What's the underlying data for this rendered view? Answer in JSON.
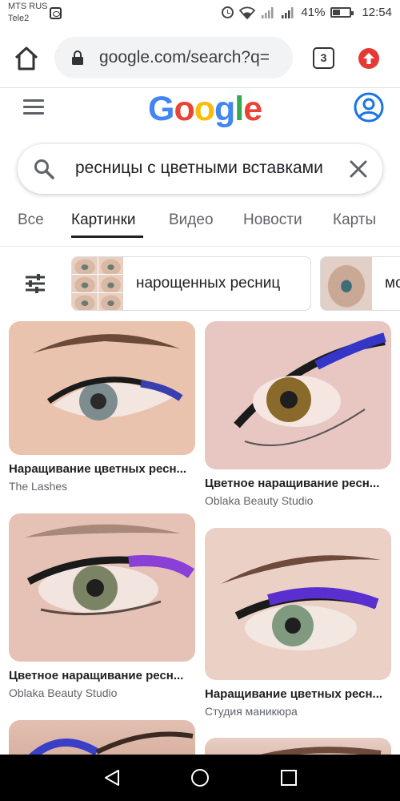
{
  "status_bar": {
    "carrier_1": "MTS RUS",
    "carrier_2": "Tele2",
    "battery": "41%",
    "time": "12:54",
    "icons": [
      "sim-icon",
      "alarm-icon",
      "wifi-icon",
      "signal-icon",
      "signal-icon",
      "battery-icon"
    ]
  },
  "browser": {
    "url": "google.com/search?q=",
    "tab_count": "3",
    "icons": [
      "home-icon",
      "lock-icon",
      "tabs-icon",
      "update-icon"
    ]
  },
  "google": {
    "logo": "Google",
    "icons": [
      "menu-icon",
      "account-icon"
    ]
  },
  "search": {
    "query": "ресницы с цветными вставками",
    "icons": [
      "search-icon",
      "clear-icon"
    ]
  },
  "tabs": [
    {
      "label": "Все",
      "active": false
    },
    {
      "label": "Картинки",
      "active": true
    },
    {
      "label": "Видео",
      "active": false
    },
    {
      "label": "Новости",
      "active": false
    },
    {
      "label": "Карты",
      "active": false
    }
  ],
  "chips": [
    {
      "label": "нарощенных ресниц"
    },
    {
      "label": "мо"
    }
  ],
  "results": [
    {
      "title": "Наращивание цветных ресн...",
      "source": "The Lashes",
      "lash_color": "#3a3fb0"
    },
    {
      "title": "Цветное наращивание ресн...",
      "source": "Oblaka Beauty Studio",
      "lash_color": "#3535c8"
    },
    {
      "title": "Цветное наращивание ресн...",
      "source": "Oblaka Beauty Studio",
      "lash_color": "#8a3fd6"
    },
    {
      "title": "Наращивание цветных ресн...",
      "source": "Студия маникюра",
      "lash_color": "#5a2fd0"
    }
  ],
  "colors": {
    "google_blue": "#4285f4",
    "google_red": "#ea4335",
    "google_yellow": "#fbbc05",
    "google_green": "#34a853"
  },
  "nav_bar": {
    "icons": [
      "back-icon",
      "home-circle-icon",
      "recents-icon"
    ]
  }
}
